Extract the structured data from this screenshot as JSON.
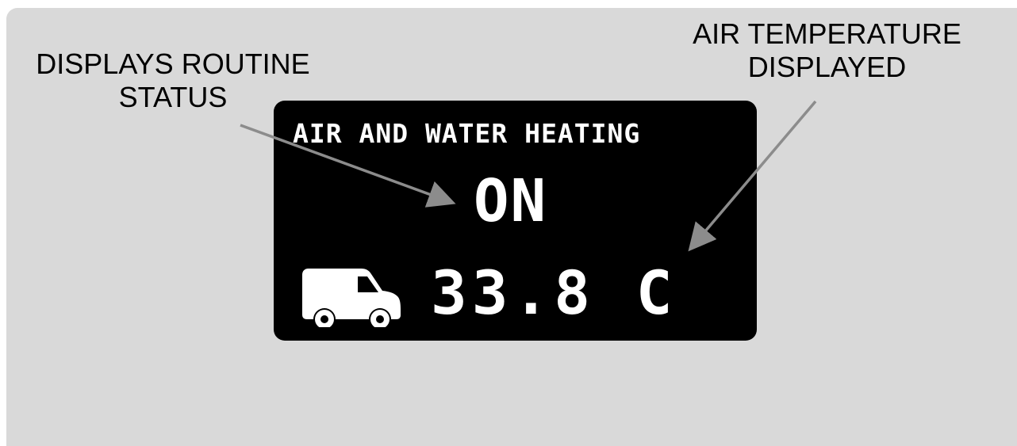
{
  "callouts": {
    "status_line1": "DISPLAYS ROUTINE",
    "status_line2": "STATUS",
    "temperature_line1": "AIR TEMPERATURE",
    "temperature_line2": "DISPLAYED"
  },
  "display": {
    "title": "AIR AND WATER HEATING",
    "status": "ON",
    "temperature": "33.8 C",
    "icon": "van-icon"
  },
  "colors": {
    "background": "#d9d9d9",
    "screen": "#000000",
    "screen_text": "#ffffff",
    "arrow": "#8c8c8c"
  }
}
